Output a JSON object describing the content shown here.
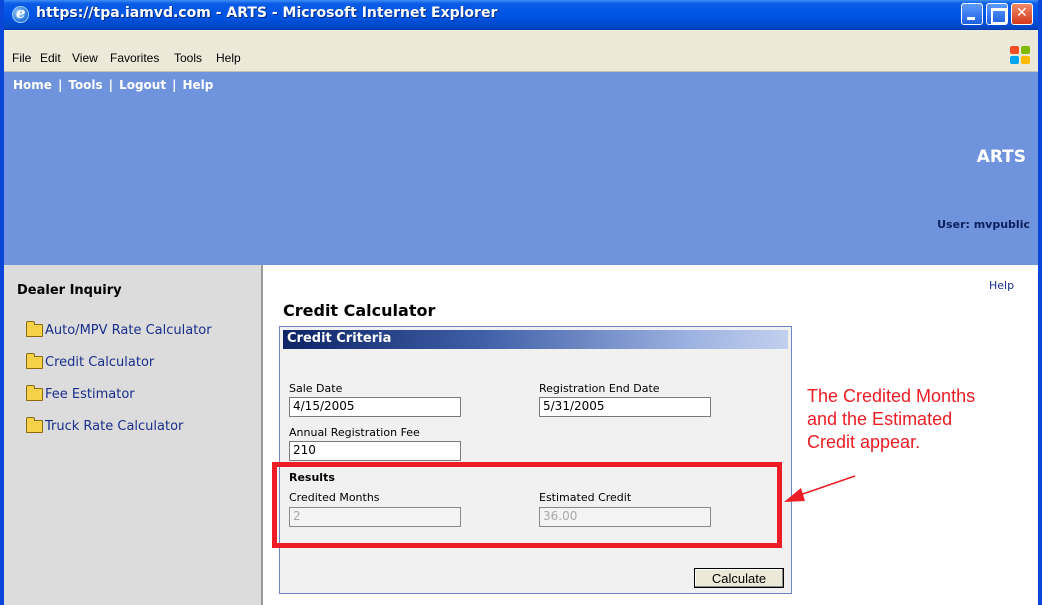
{
  "window": {
    "title": "https://tpa.iamvd.com - ARTS - Microsoft Internet Explorer"
  },
  "menu": [
    "File",
    "Edit",
    "View",
    "Favorites",
    "Tools",
    "Help"
  ],
  "header": {
    "nav": [
      "Home",
      "Tools",
      "Logout",
      "Help"
    ],
    "app_name": "ARTS",
    "user": "User: mvpublic"
  },
  "sidebar": {
    "title": "Dealer Inquiry",
    "items": [
      {
        "label": "Auto/MPV Rate Calculator",
        "icon": "folder-icon"
      },
      {
        "label": "Credit Calculator",
        "icon": "folder-icon"
      },
      {
        "label": "Fee Estimator",
        "icon": "folder-icon"
      },
      {
        "label": "Truck Rate Calculator",
        "icon": "folder-icon"
      }
    ]
  },
  "main": {
    "help": "Help",
    "title": "Credit Calculator",
    "panel_title": "Credit Criteria",
    "sale_date_label": "Sale Date",
    "sale_date": "4/15/2005",
    "reg_end_label": "Registration End Date",
    "reg_end": "5/31/2005",
    "annual_fee_label": "Annual Registration Fee",
    "annual_fee": "210",
    "results_title": "Results",
    "credited_months_label": "Credited Months",
    "credited_months": "2",
    "estimated_credit_label": "Estimated Credit",
    "estimated_credit": "36.00",
    "calculate": "Calculate"
  },
  "annotation": {
    "lines": [
      "The Credited Months",
      "and the Estimated",
      "Credit appear."
    ],
    "color": "#ee1c24"
  }
}
